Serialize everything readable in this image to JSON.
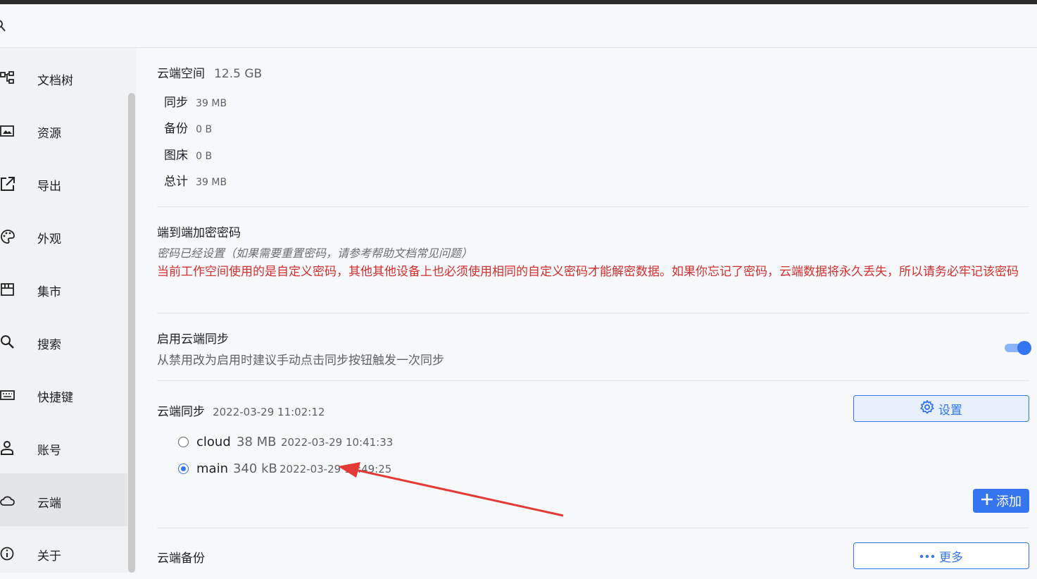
{
  "sidebar": {
    "items": [
      {
        "label": "文档树",
        "icon": "tree-icon"
      },
      {
        "label": "资源",
        "icon": "image-icon"
      },
      {
        "label": "导出",
        "icon": "export-icon"
      },
      {
        "label": "外观",
        "icon": "palette-icon"
      },
      {
        "label": "集市",
        "icon": "store-icon"
      },
      {
        "label": "搜索",
        "icon": "search-icon"
      },
      {
        "label": "快捷键",
        "icon": "keyboard-icon"
      },
      {
        "label": "账号",
        "icon": "account-icon"
      },
      {
        "label": "云端",
        "icon": "cloud-icon",
        "active": true
      },
      {
        "label": "关于",
        "icon": "info-icon"
      }
    ]
  },
  "storage": {
    "title": "云端空间",
    "total_size": "12.5 GB",
    "rows": [
      {
        "label": "同步",
        "value": "39 MB"
      },
      {
        "label": "备份",
        "value": "0 B"
      },
      {
        "label": "图床",
        "value": "0 B"
      },
      {
        "label": "总计",
        "value": "39 MB"
      }
    ]
  },
  "encryption": {
    "title": "端到端加密密码",
    "status": "密码已经设置（如果需要重置密码，请参考帮助文档常见问题）",
    "warning": "当前工作空间使用的是自定义密码，其他其他设备上也必须使用相同的自定义密码才能解密数据。如果你忘记了密码，云端数据将永久丢失，所以请务必牢记该密码"
  },
  "sync_toggle": {
    "title": "启用云端同步",
    "desc": "从禁用改为启用时建议手动点击同步按钮触发一次同步",
    "enabled": true
  },
  "cloud_sync": {
    "title": "云端同步",
    "time": "2022-03-29 11:02:12",
    "settings_label": "设置",
    "add_label": "添加",
    "dirs": [
      {
        "name": "cloud",
        "size": "38 MB",
        "time": "2022-03-29 10:41:33",
        "selected": false
      },
      {
        "name": "main",
        "size": "340 kB",
        "time": "2022-03-29 10:49:25",
        "selected": true
      }
    ]
  },
  "cloud_backup": {
    "title": "云端备份",
    "more_label": "更多"
  },
  "colors": {
    "accent": "#3575f0",
    "warning": "#d32f2f",
    "annotation_arrow": "#e53935"
  }
}
